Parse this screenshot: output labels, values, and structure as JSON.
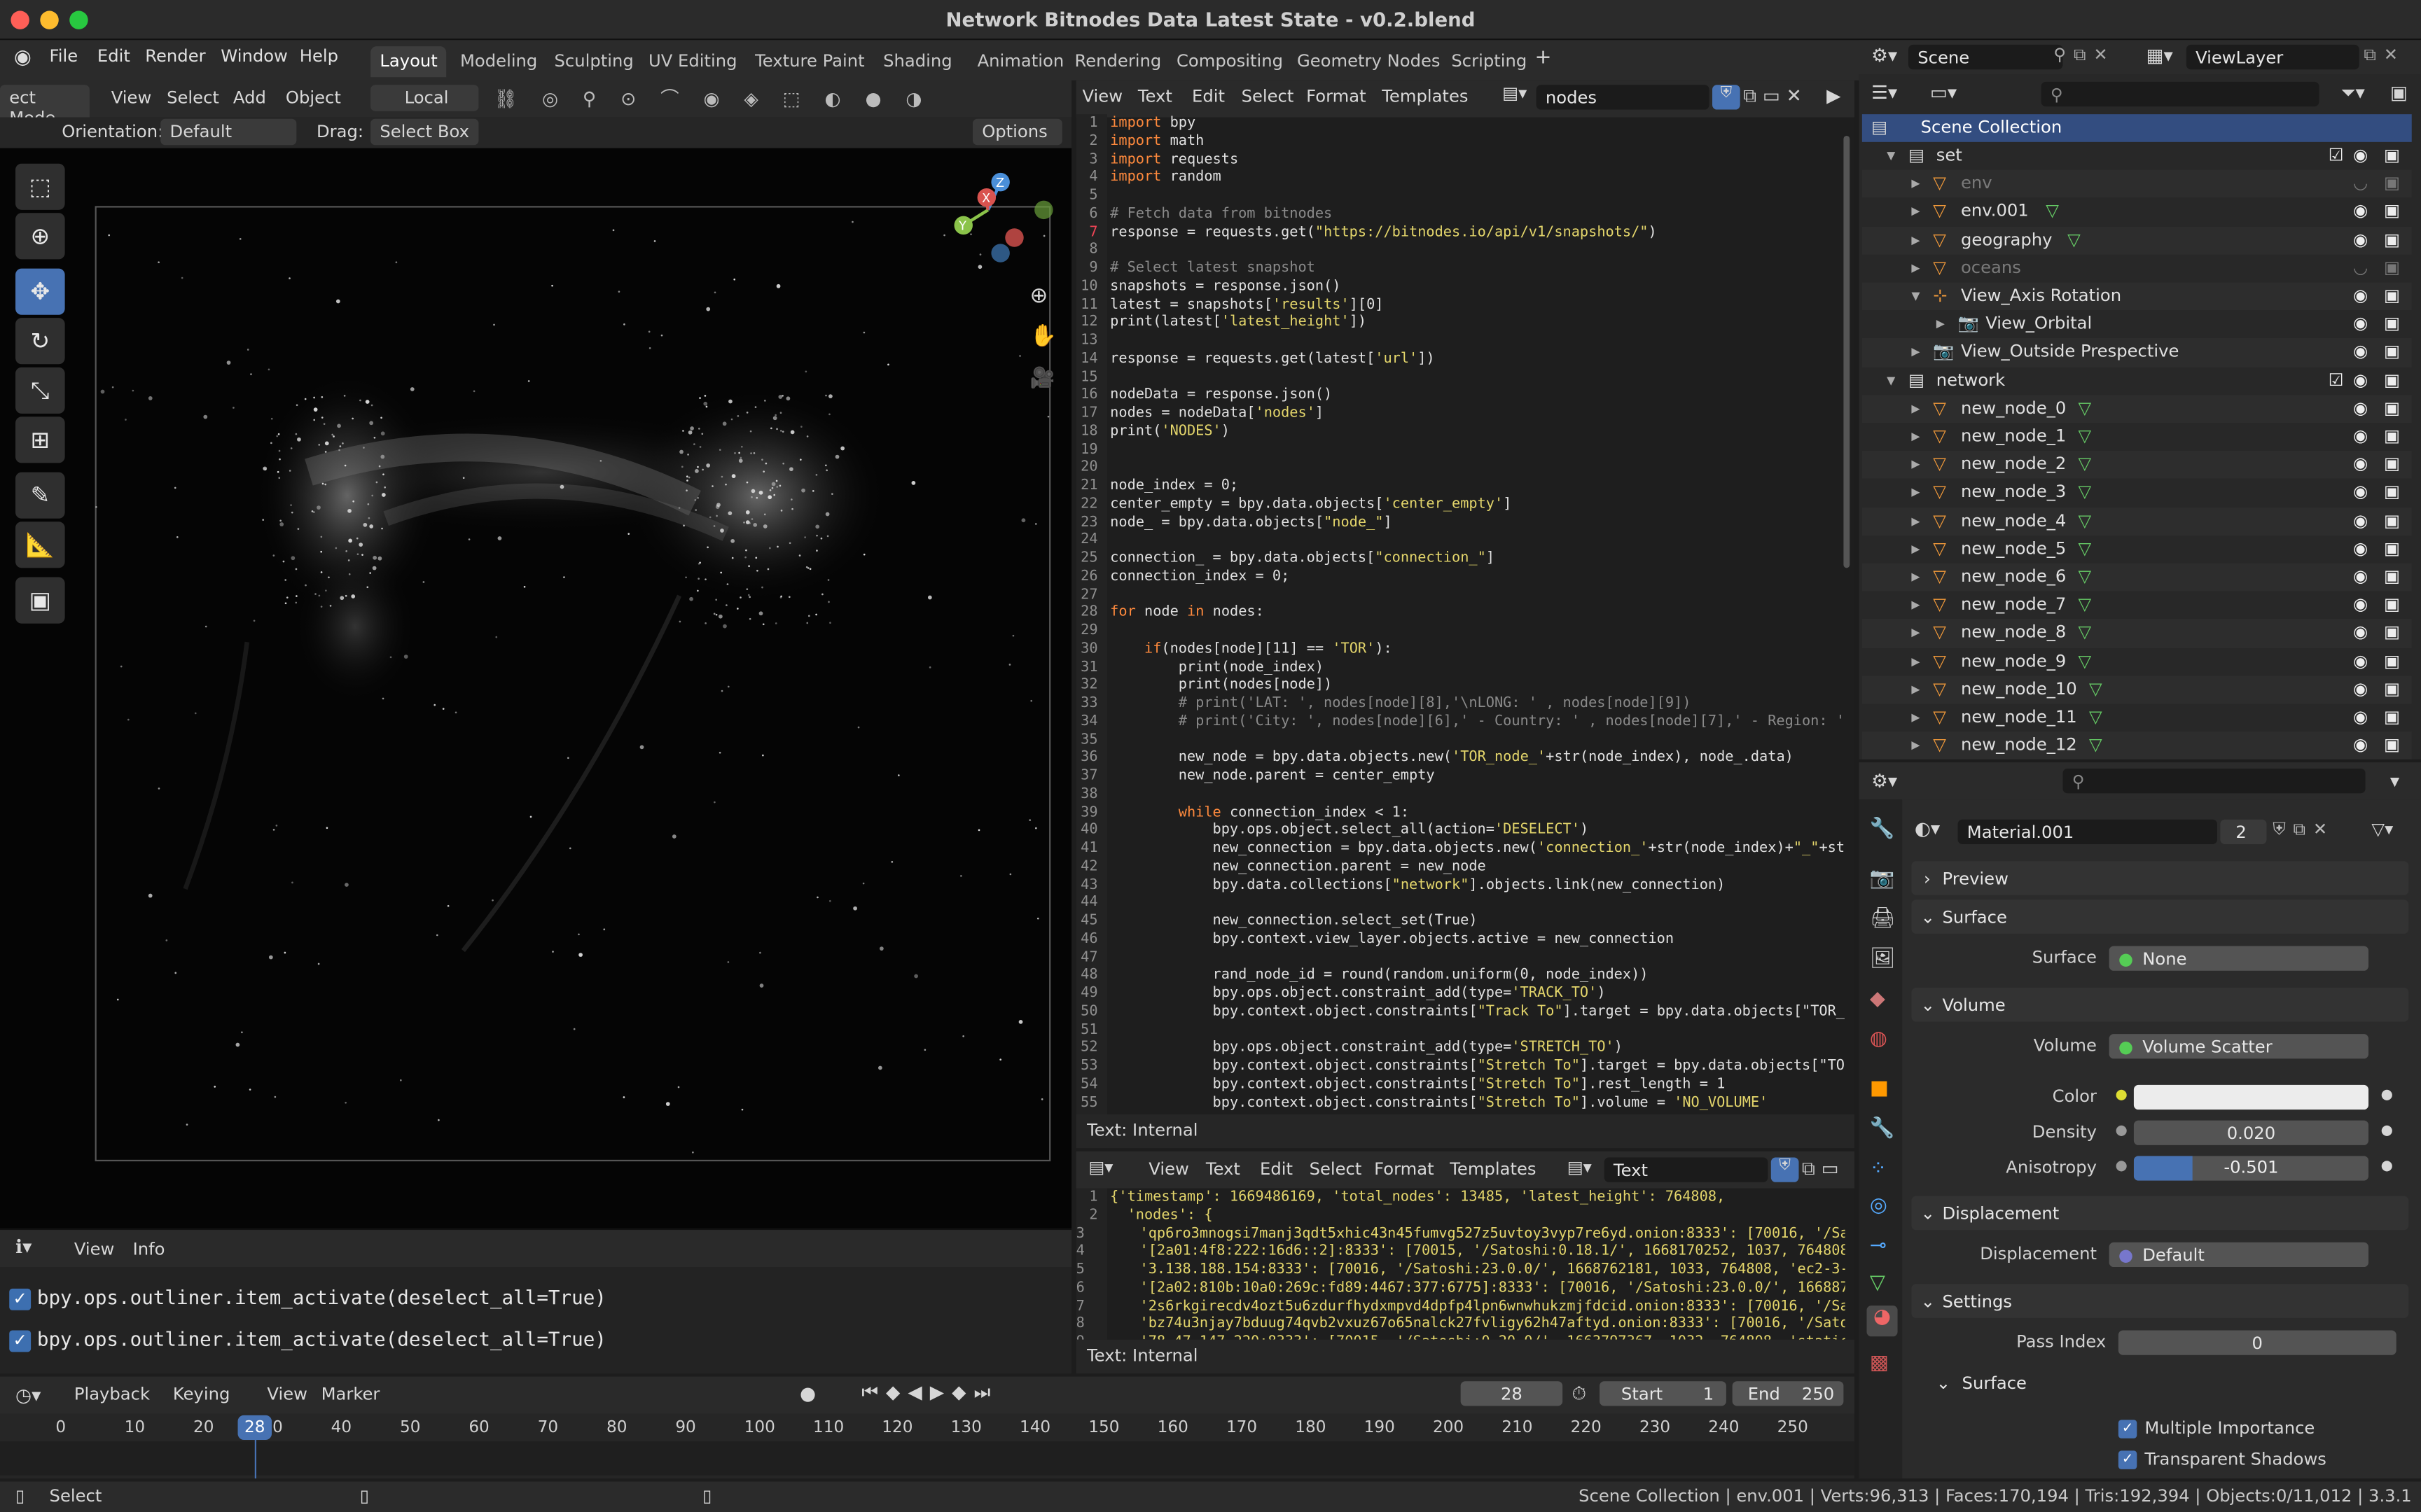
{
  "window": {
    "title": "Network Bitnodes Data Latest State - v0.2.blend"
  },
  "menus": [
    "File",
    "Edit",
    "Render",
    "Window",
    "Help"
  ],
  "workspaces": [
    "Layout",
    "Modeling",
    "Sculpting",
    "UV Editing",
    "Texture Paint",
    "Shading",
    "Animation",
    "Rendering",
    "Compositing",
    "Geometry Nodes",
    "Scripting"
  ],
  "add_workspace": "+",
  "viewport": {
    "mode": "ect Mode",
    "menus": [
      "View",
      "Select",
      "Add",
      "Object"
    ],
    "transform": "Local",
    "orientation_label": "Orientation:",
    "orientation": "Default",
    "drag_label": "Drag:",
    "drag": "Select Box",
    "options": "Options"
  },
  "text_editor": {
    "menus": [
      "View",
      "Text",
      "Edit",
      "Select",
      "Format",
      "Templates"
    ],
    "file": "nodes",
    "footer": "Text: Internal",
    "lines": [
      [
        "1",
        "import bpy"
      ],
      [
        "2",
        "import math"
      ],
      [
        "3",
        "import requests"
      ],
      [
        "4",
        "import random"
      ],
      [
        "5",
        ""
      ],
      [
        "6",
        "# Fetch data from bitnodes"
      ],
      [
        "7",
        "response = requests.get(\"https://bitnodes.io/api/v1/snapshots/\")"
      ],
      [
        "8",
        ""
      ],
      [
        "9",
        "# Select latest snapshot"
      ],
      [
        "10",
        "snapshots = response.json()"
      ],
      [
        "11",
        "latest = snapshots['results'][0]"
      ],
      [
        "12",
        "print(latest['latest_height'])"
      ],
      [
        "13",
        ""
      ],
      [
        "14",
        "response = requests.get(latest['url'])"
      ],
      [
        "15",
        ""
      ],
      [
        "16",
        "nodeData = response.json()"
      ],
      [
        "17",
        "nodes = nodeData['nodes']"
      ],
      [
        "18",
        "print('NODES')"
      ],
      [
        "19",
        ""
      ],
      [
        "20",
        ""
      ],
      [
        "21",
        "node_index = 0;"
      ],
      [
        "22",
        "center_empty = bpy.data.objects['center_empty']"
      ],
      [
        "23",
        "node_ = bpy.data.objects[\"node_\"]"
      ],
      [
        "24",
        ""
      ],
      [
        "25",
        "connection_ = bpy.data.objects[\"connection_\"]"
      ],
      [
        "26",
        "connection_index = 0;"
      ],
      [
        "27",
        ""
      ],
      [
        "28",
        "for node in nodes:"
      ],
      [
        "29",
        ""
      ],
      [
        "30",
        "    if(nodes[node][11] == 'TOR'):"
      ],
      [
        "31",
        "        print(node_index)"
      ],
      [
        "32",
        "        print(nodes[node])"
      ],
      [
        "33",
        "        # print('LAT: ', nodes[node][8],'\\nLONG: ' , nodes[node][9])"
      ],
      [
        "34",
        "        # print('City: ', nodes[node][6],' - Country: ' , nodes[node][7],' - Region: '"
      ],
      [
        "35",
        ""
      ],
      [
        "36",
        "        new_node = bpy.data.objects.new('TOR_node_'+str(node_index), node_.data)"
      ],
      [
        "37",
        "        new_node.parent = center_empty"
      ],
      [
        "38",
        ""
      ],
      [
        "39",
        "        while connection_index < 1:"
      ],
      [
        "40",
        "            bpy.ops.object.select_all(action='DESELECT')"
      ],
      [
        "41",
        "            new_connection = bpy.data.objects.new('connection_'+str(node_index)+\"_\"+st"
      ],
      [
        "42",
        "            new_connection.parent = new_node"
      ],
      [
        "43",
        "            bpy.data.collections[\"network\"].objects.link(new_connection)"
      ],
      [
        "44",
        ""
      ],
      [
        "45",
        "            new_connection.select_set(True)"
      ],
      [
        "46",
        "            bpy.context.view_layer.objects.active = new_connection"
      ],
      [
        "47",
        ""
      ],
      [
        "48",
        "            rand_node_id = round(random.uniform(0, node_index))"
      ],
      [
        "49",
        "            bpy.ops.object.constraint_add(type='TRACK_TO')"
      ],
      [
        "50",
        "            bpy.context.object.constraints[\"Track To\"].target = bpy.data.objects[\"TOR_"
      ],
      [
        "51",
        ""
      ],
      [
        "52",
        "            bpy.ops.object.constraint_add(type='STRETCH_TO')"
      ],
      [
        "53",
        "            bpy.context.object.constraints[\"Stretch To\"].target = bpy.data.objects[\"TO"
      ],
      [
        "54",
        "            bpy.context.object.constraints[\"Stretch To\"].rest_length = 1"
      ],
      [
        "55",
        "            bpy.context.object.constraints[\"Stretch To\"].volume = 'NO_VOLUME'"
      ]
    ]
  },
  "text_editor2": {
    "menus": [
      "View",
      "Text",
      "Edit",
      "Select",
      "Format",
      "Templates"
    ],
    "file": "Text",
    "footer": "Text: Internal",
    "lines": [
      [
        "1",
        "{'timestamp': 1669486169, 'total_nodes': 13485, 'latest_height': 764808,"
      ],
      [
        "2",
        "  'nodes': {"
      ],
      [
        "3",
        "     'qp6ro3mnogsi7manj3qdt5xhic43n45fumvg527z5uvtoy3vyp7re6yd.onion:8333': [70016, '/Satoshi:23.0.0/"
      ],
      [
        "4",
        "     '[2a01:4f8:222:16d6::2]:8333': [70015, '/Satoshi:0.18.1/', 1668170252, 1037, 764808, '2a01:4f8:2"
      ],
      [
        "5",
        "     '3.138.188.154:8333': [70016, '/Satoshi:23.0.0/', 1668762181, 1033, 764808, 'ec2-3-138-188-154.u"
      ],
      [
        "6",
        "     '[2a02:810b:10a0:269c:fd89:4467:377:6775]:8333': [70016, '/Satoshi:23.0.0/', 1668876864, 1033, 7"
      ],
      [
        "7",
        "     '2s6rkgirecdv4ozt5u6zdurfhydxmpvd4dpfp4lpn6wnwhukzmjfdcid.onion:8333': [70016, '/Satoshi:22.0.0("
      ],
      [
        "8",
        "     'bz74u3njay7bduug74qvb2vxuz67o65nalck27fvligy62h47aftyd.onion:8333': [70016, '/Satoshi:23.0.0/"
      ],
      [
        "9",
        "     '78.47.147.220:8333': [70015, '/Satoshi:0.20.0/', 1663797367, 1032, 764808, 'static.220.147.47.7"
      ]
    ]
  },
  "info": {
    "menus": [
      "View",
      "Info"
    ],
    "entries": [
      "bpy.ops.outliner.item_activate(deselect_all=True)",
      "bpy.ops.outliner.item_activate(deselect_all=True)"
    ]
  },
  "outliner": {
    "scene": "Scene",
    "view_layer": "ViewLayer",
    "root": "Scene Collection",
    "rows": [
      {
        "label": "set",
        "indent": 1,
        "type": "collection"
      },
      {
        "label": "env",
        "indent": 2,
        "type": "mesh",
        "dim": true
      },
      {
        "label": "env.001",
        "indent": 2,
        "type": "mesh"
      },
      {
        "label": "geography",
        "indent": 2,
        "type": "mesh"
      },
      {
        "label": "oceans",
        "indent": 2,
        "type": "mesh",
        "dim": true
      },
      {
        "label": "View_Axis Rotation",
        "indent": 2,
        "type": "empty"
      },
      {
        "label": "View_Orbital",
        "indent": 3,
        "type": "camera"
      },
      {
        "label": "View_Outside Prespective",
        "indent": 2,
        "type": "camera"
      },
      {
        "label": "network",
        "indent": 1,
        "type": "collection"
      },
      {
        "label": "new_node_0",
        "indent": 2,
        "type": "mesh"
      },
      {
        "label": "new_node_1",
        "indent": 2,
        "type": "mesh"
      },
      {
        "label": "new_node_2",
        "indent": 2,
        "type": "mesh"
      },
      {
        "label": "new_node_3",
        "indent": 2,
        "type": "mesh"
      },
      {
        "label": "new_node_4",
        "indent": 2,
        "type": "mesh"
      },
      {
        "label": "new_node_5",
        "indent": 2,
        "type": "mesh"
      },
      {
        "label": "new_node_6",
        "indent": 2,
        "type": "mesh"
      },
      {
        "label": "new_node_7",
        "indent": 2,
        "type": "mesh"
      },
      {
        "label": "new_node_8",
        "indent": 2,
        "type": "mesh"
      },
      {
        "label": "new_node_9",
        "indent": 2,
        "type": "mesh"
      },
      {
        "label": "new_node_10",
        "indent": 2,
        "type": "mesh"
      },
      {
        "label": "new_node_11",
        "indent": 2,
        "type": "mesh"
      },
      {
        "label": "new_node_12",
        "indent": 2,
        "type": "mesh"
      }
    ]
  },
  "properties": {
    "material": "Material.001",
    "users": "2",
    "preview": "Preview",
    "surface_section": "Surface",
    "surface_label": "Surface",
    "surface_value": "None",
    "volume_section": "Volume",
    "volume_label": "Volume",
    "volume_value": "Volume Scatter",
    "color_label": "Color",
    "density_label": "Density",
    "density_value": "0.020",
    "anisotropy_label": "Anisotropy",
    "anisotropy_value": "-0.501",
    "anisotropy_fill": 0.25,
    "displacement_section": "Displacement",
    "displacement_label": "Displacement",
    "displacement_value": "Default",
    "settings_section": "Settings",
    "pass_index_label": "Pass Index",
    "pass_index_value": "0",
    "surface_sub": "Surface",
    "multiple_importance": "Multiple Importance",
    "transparent_shadows": "Transparent Shadows"
  },
  "timeline": {
    "menus": [
      "Playback",
      "Keying",
      "View",
      "Marker"
    ],
    "current_frame": "28",
    "start_label": "Start",
    "start": "1",
    "end_label": "End",
    "end": "250",
    "ticks": [
      "0",
      "10",
      "20",
      "30",
      "40",
      "50",
      "60",
      "70",
      "80",
      "90",
      "100",
      "110",
      "120",
      "130",
      "140",
      "150",
      "160",
      "170",
      "180",
      "190",
      "200",
      "210",
      "220",
      "230",
      "240",
      "250"
    ]
  },
  "status": {
    "left": "Select",
    "right": "Scene Collection | env.001 | Verts:96,313 | Faces:170,194 | Tris:192,394 | Objects:0/11,012 | 3.3.1"
  },
  "colors": {
    "accent": "#4772b3",
    "keyword": "#ff8a3d",
    "string": "#e3d56b",
    "comment": "#8a8a8a",
    "number": "#4fa8e8"
  }
}
